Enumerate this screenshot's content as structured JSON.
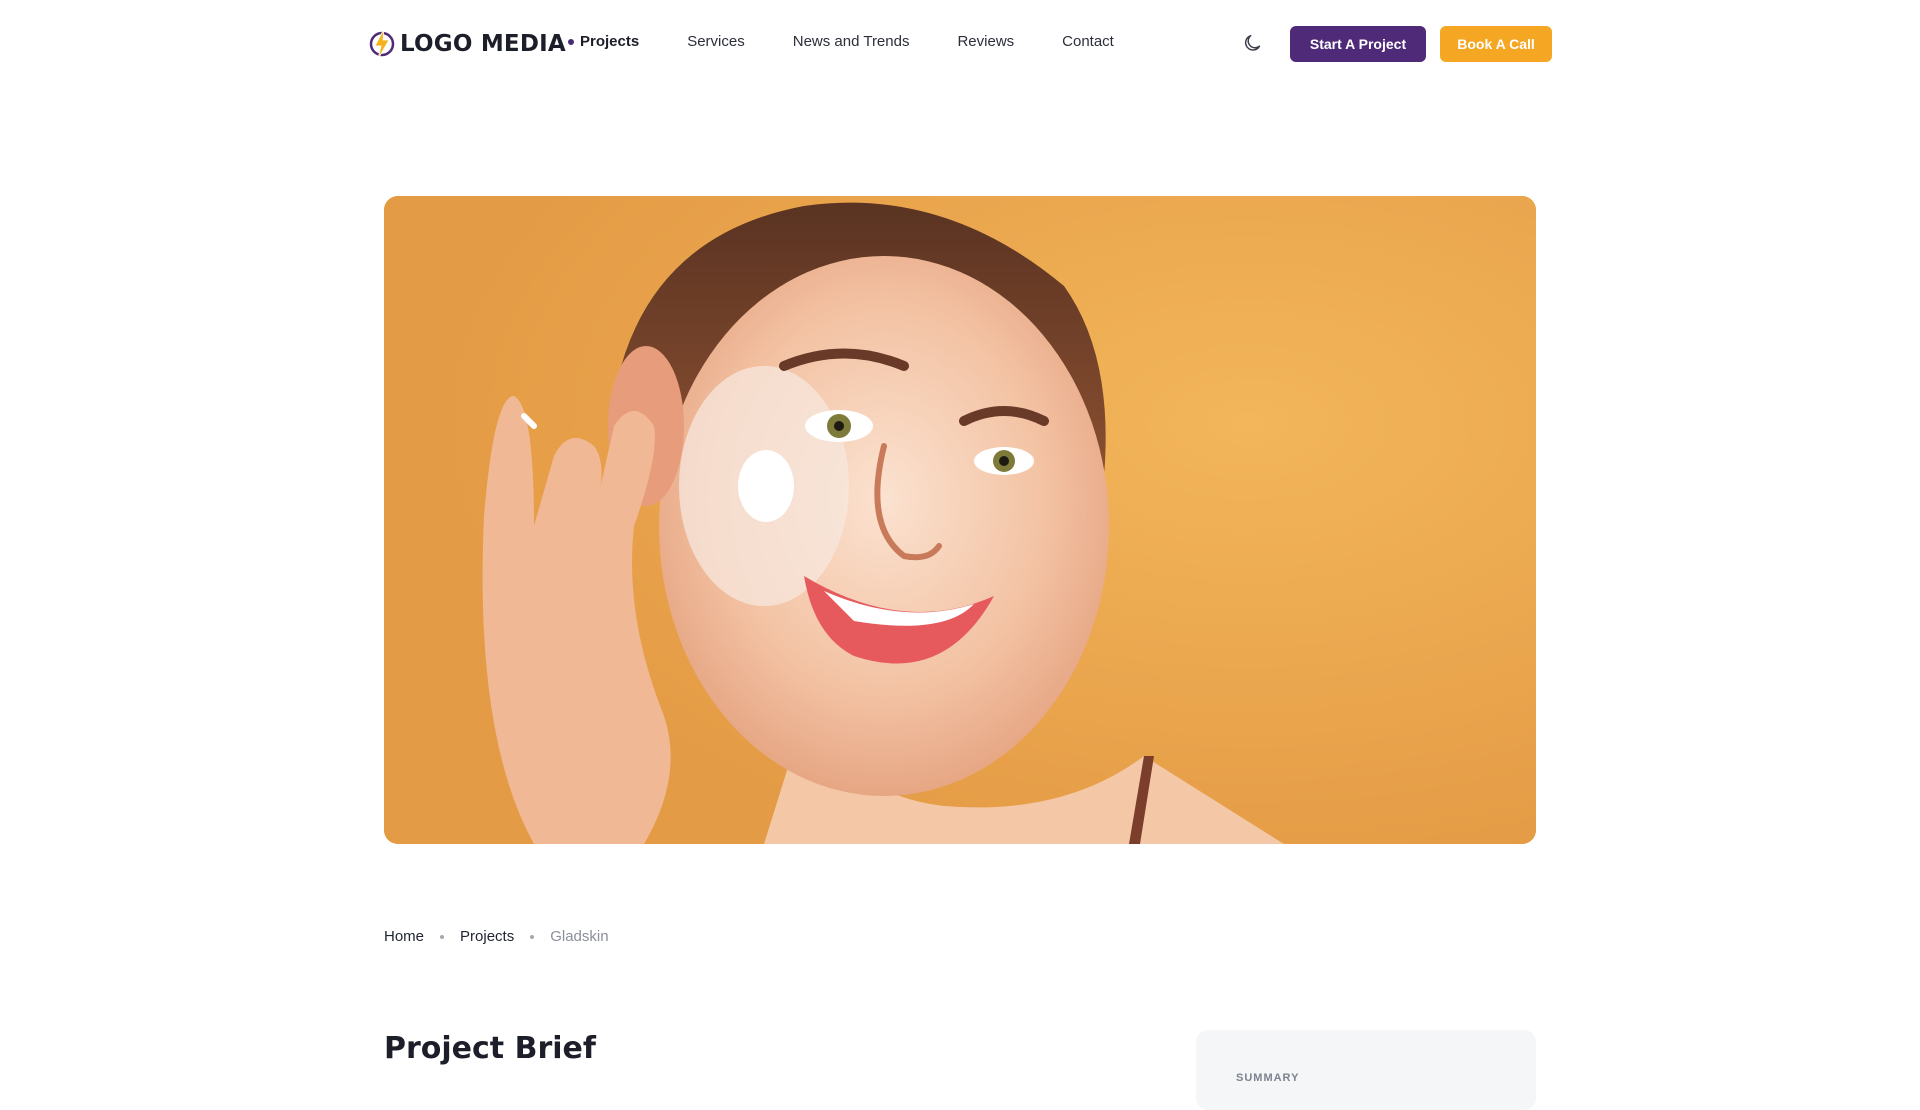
{
  "header": {
    "logo_text": "LOGO MEDIA",
    "nav": [
      "Projects",
      "Services",
      "News and Trends",
      "Reviews",
      "Contact"
    ],
    "active_nav": "Projects",
    "theme_toggle_icon": "moon-icon",
    "start_project_label": "Start A Project",
    "book_call_label": "Book A Call"
  },
  "hero": {
    "image_icon": "hero-image"
  },
  "breadcrumb": {
    "items": [
      "Home",
      "Projects",
      "Gladskin"
    ]
  },
  "brief": {
    "title": "Project Brief",
    "summary_label": "SUMMARY"
  },
  "colors": {
    "primary": "#4f2a78",
    "accent": "#f5a623",
    "hero_bg": "#eaa64a"
  }
}
